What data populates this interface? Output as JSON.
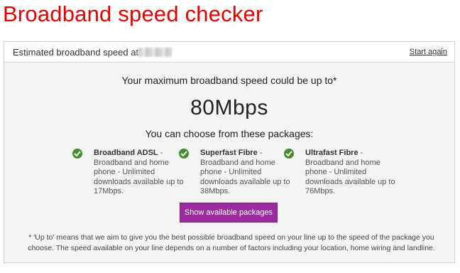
{
  "page": {
    "title": "Broadband speed checker"
  },
  "header": {
    "label": "Estimated broadband speed at",
    "start_again": "Start again"
  },
  "result": {
    "headline": "Your maximum broadband speed could be up to*",
    "speed": "80Mbps",
    "packages_intro": "You can choose from these packages:"
  },
  "packages": [
    {
      "name": "Broadband ADSL",
      "desc": "Broadband and home phone - Unlimited downloads available up to 17Mbps."
    },
    {
      "name": "Superfast Fibre",
      "desc": "Broadband and home phone - Unlimited downloads available up to 38Mbps."
    },
    {
      "name": "Ultrafast Fibre",
      "desc": "Broadband and home phone - Unlimited downloads available up to 76Mbps."
    }
  ],
  "cta": {
    "label": "Show available packages"
  },
  "footnote": "* 'Up to' means that we aim to give you the best possible broadband speed on your line up to the speed of the package you choose. The speed available on your line depends on a number of factors including your location, home wiring and landline.",
  "colors": {
    "brand_red": "#e60000",
    "cta_purple": "#9c2aa0",
    "check_green": "#438e2a"
  },
  "icons": {
    "check": "check-circle-icon"
  }
}
